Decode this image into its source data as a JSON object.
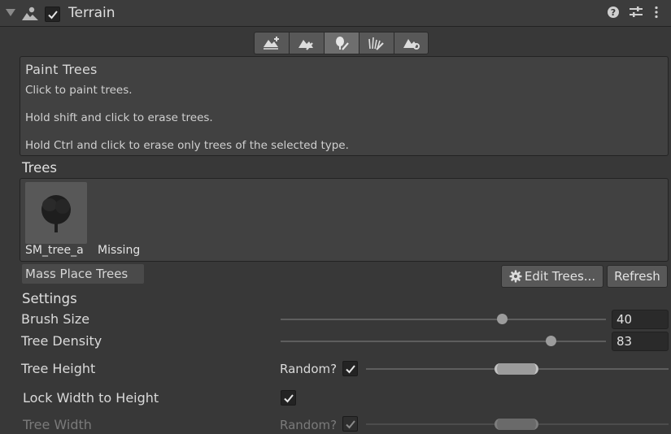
{
  "header": {
    "title": "Terrain",
    "enabled": true,
    "icons": [
      "foldout-arrow-icon",
      "terrain-icon",
      "help-icon",
      "settings-sliders-icon",
      "kebab-menu-icon"
    ]
  },
  "toolbar": {
    "tools": [
      {
        "name": "create-neighbor-terrains",
        "icon": "terrain-plus-icon"
      },
      {
        "name": "paint-terrain",
        "icon": "terrain-brush-icon"
      },
      {
        "name": "paint-trees",
        "icon": "tree-brush-icon",
        "active": true
      },
      {
        "name": "paint-details",
        "icon": "grass-brush-icon"
      },
      {
        "name": "terrain-settings",
        "icon": "terrain-gear-icon"
      }
    ]
  },
  "help": {
    "title": "Paint Trees",
    "lines": [
      "Click to paint trees.",
      "Hold shift and click to erase trees.",
      "Hold Ctrl and click to erase only trees of the selected type."
    ]
  },
  "trees": {
    "label": "Trees",
    "items": [
      {
        "name": "SM_tree_a",
        "icon": "tree-thumbnail"
      },
      {
        "name": "Missing"
      }
    ]
  },
  "buttons": {
    "mass_place": "Mass Place Trees",
    "edit_trees": "Edit Trees...",
    "refresh": "Refresh"
  },
  "settings": {
    "label": "Settings",
    "brush_size": {
      "label": "Brush Size",
      "value": "40",
      "slider_fraction": 0.68
    },
    "tree_density": {
      "label": "Tree Density",
      "value": "83",
      "slider_fraction": 0.83
    },
    "tree_height": {
      "label": "Tree Height",
      "random_label": "Random?",
      "random_checked": true
    },
    "lock_width": {
      "label": "Lock Width to Height",
      "checked": true
    },
    "tree_width": {
      "label": "Tree Width",
      "random_label": "Random?",
      "random_checked": true,
      "disabled": true
    }
  }
}
